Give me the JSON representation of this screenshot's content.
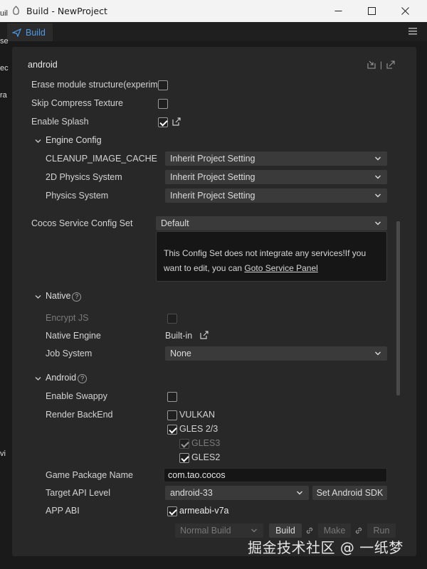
{
  "window": {
    "title": "Build - NewProject"
  },
  "tab": {
    "label": "Build"
  },
  "edge_text": [
    "uil",
    "se",
    "ec",
    "ra",
    "vi"
  ],
  "panel": {
    "platform": "android",
    "general": {
      "erase_module": "Erase module structure(experim",
      "skip_compress": "Skip Compress Texture",
      "enable_splash": "Enable Splash"
    },
    "engine_config": {
      "header": "Engine Config",
      "rows": [
        {
          "label": "CLEANUP_IMAGE_CACHE",
          "value": "Inherit Project Setting"
        },
        {
          "label": "2D Physics System",
          "value": "Inherit Project Setting"
        },
        {
          "label": "Physics System",
          "value": "Inherit Project Setting"
        }
      ]
    },
    "service": {
      "label": "Cocos Service Config Set",
      "value": "Default",
      "info_text": "This Config Set does not integrate any services!If you want to edit, you can ",
      "link_text": "Goto Service Panel"
    },
    "native": {
      "header": "Native",
      "encrypt_js": "Encrypt JS",
      "native_engine": "Native Engine",
      "native_engine_value": "Built-in",
      "job_system": "Job System",
      "job_system_value": "None"
    },
    "android": {
      "header": "Android",
      "enable_swappy": "Enable Swappy",
      "render_backend": "Render BackEnd",
      "backends": [
        "VULKAN",
        "GLES 2/3",
        "GLES3",
        "GLES2"
      ],
      "package_name_label": "Game Package Name",
      "package_name": "com.tao.cocos",
      "target_api_label": "Target API Level",
      "target_api": "android-33",
      "set_sdk": "Set Android SDK",
      "app_abi_label": "APP ABI",
      "abi": "armeabi-v7a"
    },
    "footer": {
      "build_mode": "Normal Build",
      "build": "Build",
      "make": "Make",
      "run": "Run"
    }
  },
  "watermark": "掘金技术社区 @ 一纸梦"
}
